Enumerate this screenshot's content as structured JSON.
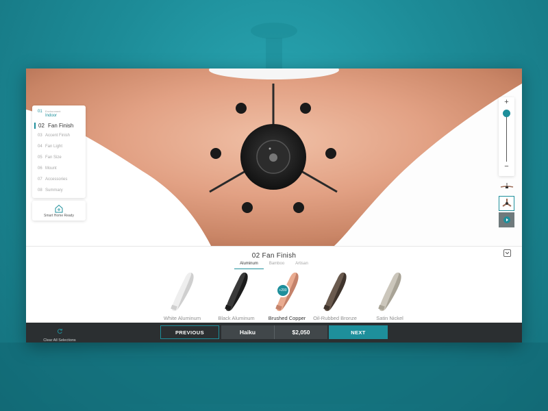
{
  "steps": {
    "items": [
      {
        "num": "01",
        "sub": "Environment",
        "label": "Indoor"
      },
      {
        "num": "02",
        "label": "Fan Finish"
      },
      {
        "num": "03",
        "label": "Accent Finish"
      },
      {
        "num": "04",
        "label": "Fan Light"
      },
      {
        "num": "05",
        "label": "Fan Size"
      },
      {
        "num": "06",
        "label": "Mount"
      },
      {
        "num": "07",
        "label": "Accessories"
      },
      {
        "num": "08",
        "label": "Summary"
      }
    ]
  },
  "smart_home": {
    "label": "Smart Home Ready",
    "icon": "smart-home-icon"
  },
  "zoom": {
    "plus": "+",
    "minus": "−",
    "level": 0.95
  },
  "panel": {
    "title": "02 Fan Finish",
    "tabs": [
      "Aluminum",
      "Bamboo",
      "Artisan"
    ],
    "active_tab": "Aluminum",
    "swatches": [
      {
        "name": "White Aluminum",
        "color": "#eeeeee",
        "shade": "#cfcfcf"
      },
      {
        "name": "Black Aluminum",
        "color": "#3a3a3a",
        "shade": "#1c1c1c"
      },
      {
        "name": "Brushed Copper",
        "color": "#e9ab90",
        "shade": "#c4826a",
        "badge": "+200"
      },
      {
        "name": "Oil-Rubbed Bronze",
        "color": "#6a5a4e",
        "shade": "#3f342c"
      },
      {
        "name": "Satin Nickel",
        "color": "#cbc6bb",
        "shade": "#a8a396"
      }
    ],
    "selected": "Brushed Copper"
  },
  "bar": {
    "clear_label": "Clear All Selections",
    "previous": "PREVIOUS",
    "model": "Haiku",
    "price": "$2,050",
    "next": "NEXT"
  },
  "colors": {
    "accent": "#1e8f9b",
    "bar": "#2b2f31",
    "copper": "#e2a184"
  }
}
